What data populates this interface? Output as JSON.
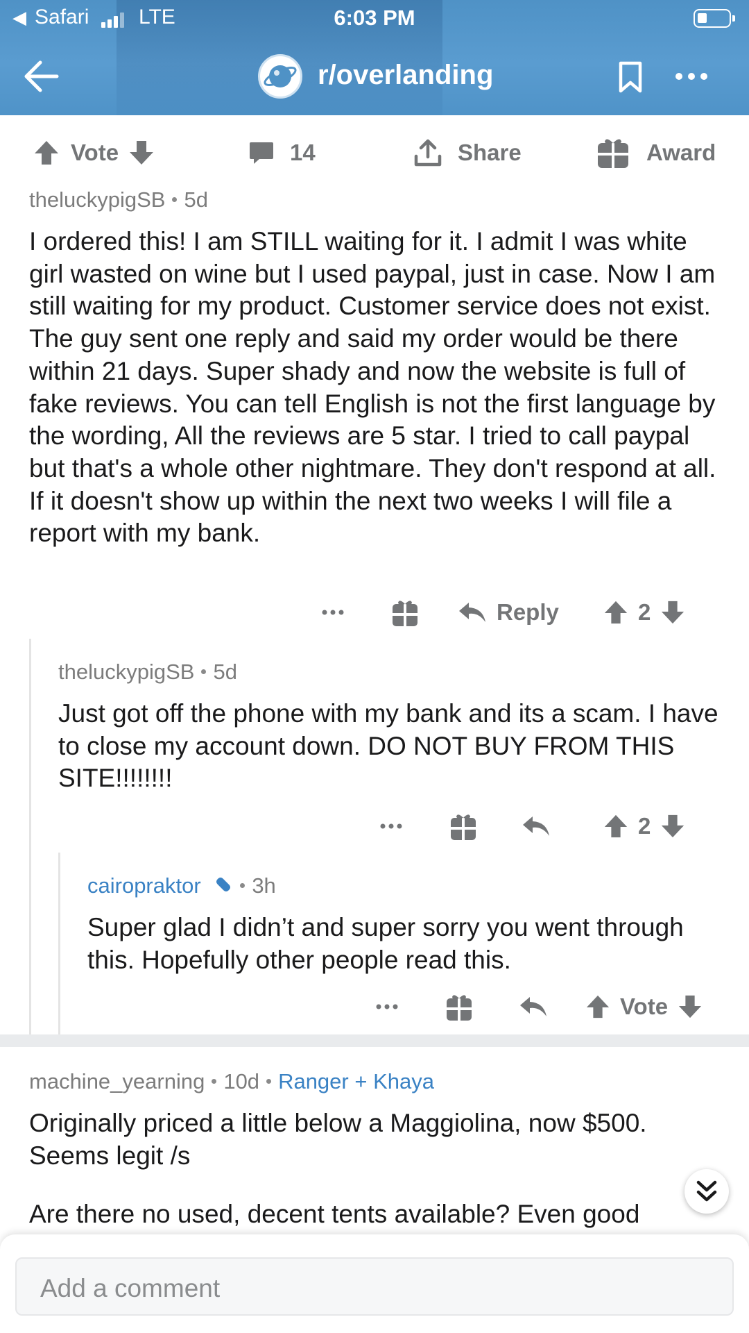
{
  "status_bar": {
    "back_app": "Safari",
    "network": "LTE",
    "time": "6:03 PM"
  },
  "nav": {
    "subreddit": "r/overlanding",
    "icons": [
      "back-arrow-icon",
      "subreddit-planet-icon",
      "bookmark-icon",
      "more-icon"
    ]
  },
  "post_actions": {
    "vote_label": "Vote",
    "comment_count": "14",
    "share_label": "Share",
    "award_label": "Award"
  },
  "comments": [
    {
      "author": "theluckypigSB",
      "age": "5d",
      "body": "I ordered this! I am STILL waiting for it. I admit I was white girl wasted on wine but I used paypal, just in case. Now I am still waiting for my product. Customer service does not exist. The guy sent one reply and said my order would be there within 21 days. Super shady and now the website is full of fake reviews. You can tell English is not the first language by the wording, All the reviews are 5 star.  I tried to call paypal but that's a whole other nightmare. They don't respond at all. If it doesn't show up within the next two weeks I will file a report with my bank.",
      "reply_label": "Reply",
      "score": "2"
    },
    {
      "author": "theluckypigSB",
      "age": "5d",
      "body": "Just got off the phone with my bank and its a scam. I have to close my account down. DO NOT BUY FROM THIS SITE!!!!!!!!",
      "score": "2"
    },
    {
      "author": "cairopraktor",
      "age": "3h",
      "body": "Super glad I didn’t and super sorry you went through this. Hopefully other people read this.",
      "vote_label": "Vote"
    },
    {
      "author": "machine_yearning",
      "age": "10d",
      "flair": "Ranger + Khaya",
      "body_1": "Originally priced a little below a Maggiolina, now $500. Seems legit /s",
      "body_2": "Are there no used, decent tents available? Even good"
    }
  ],
  "composer": {
    "placeholder": "Add a comment"
  },
  "colors": {
    "header_blue": "#5a9cd0",
    "link_blue": "#3a82c4",
    "icon_gray": "#737577"
  }
}
